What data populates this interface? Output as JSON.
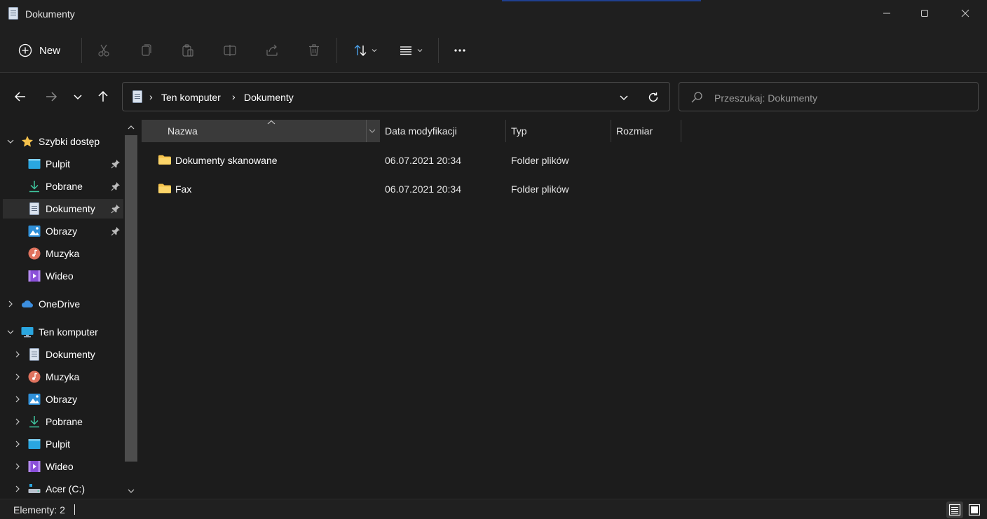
{
  "window": {
    "title": "Dokumenty",
    "accent_color": "#1f3f8f"
  },
  "commandbar": {
    "new_label": "New",
    "icons": [
      "new-icon",
      "cut-icon",
      "copy-icon",
      "paste-icon",
      "rename-icon",
      "share-icon",
      "delete-icon",
      "sort-icon",
      "view-icon",
      "more-icon"
    ]
  },
  "address": {
    "crumbs": [
      "Ten komputer",
      "Dokumenty"
    ]
  },
  "search": {
    "placeholder": "Przeszukaj: Dokumenty"
  },
  "sidebar": {
    "quick_access": {
      "label": "Szybki dostęp",
      "items": [
        {
          "label": "Pulpit",
          "pinned": true
        },
        {
          "label": "Pobrane",
          "pinned": true
        },
        {
          "label": "Dokumenty",
          "pinned": true,
          "selected": true
        },
        {
          "label": "Obrazy",
          "pinned": true
        },
        {
          "label": "Muzyka",
          "pinned": false
        },
        {
          "label": "Wideo",
          "pinned": false
        }
      ]
    },
    "onedrive": {
      "label": "OneDrive"
    },
    "this_pc": {
      "label": "Ten komputer",
      "items": [
        {
          "label": "Dokumenty"
        },
        {
          "label": "Muzyka"
        },
        {
          "label": "Obrazy"
        },
        {
          "label": "Pobrane"
        },
        {
          "label": "Pulpit"
        },
        {
          "label": "Wideo"
        },
        {
          "label": "Acer (C:)"
        }
      ]
    }
  },
  "files": {
    "columns": [
      "Nazwa",
      "Data modyfikacji",
      "Typ",
      "Rozmiar"
    ],
    "rows": [
      {
        "name": "Dokumenty skanowane",
        "modified": "06.07.2021 20:34",
        "type": "Folder plików",
        "size": ""
      },
      {
        "name": "Fax",
        "modified": "06.07.2021 20:34",
        "type": "Folder plików",
        "size": ""
      }
    ]
  },
  "status": {
    "count_text": "Elementy: 2"
  },
  "colors": {
    "folder": "#f5c24c",
    "star": "#f5c24c",
    "onedrive": "#3c8fe0",
    "background": "#1c1c1c"
  }
}
